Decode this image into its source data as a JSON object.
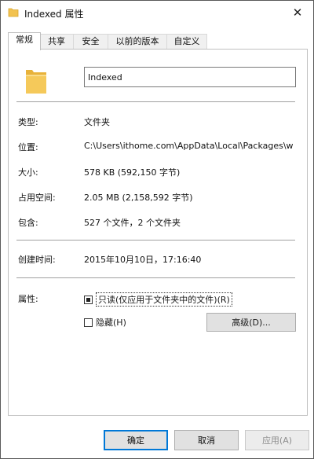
{
  "window": {
    "title": "Indexed 属性",
    "close_glyph": "✕"
  },
  "tabs": [
    {
      "label": "常规",
      "active": true
    },
    {
      "label": "共享",
      "active": false
    },
    {
      "label": "安全",
      "active": false
    },
    {
      "label": "以前的版本",
      "active": false
    },
    {
      "label": "自定义",
      "active": false
    }
  ],
  "general": {
    "folder_name": "Indexed",
    "type_label": "类型:",
    "type_value": "文件夹",
    "location_label": "位置:",
    "location_value": "C:\\Users\\ithome.com\\AppData\\Local\\Packages\\w",
    "size_label": "大小:",
    "size_value": "578 KB (592,150 字节)",
    "disk_size_label": "占用空间:",
    "disk_size_value": "2.05 MB (2,158,592 字节)",
    "contains_label": "包含:",
    "contains_value": "527 个文件，2 个文件夹",
    "created_label": "创建时间:",
    "created_value": "2015年10月10日，17:16:40",
    "attributes_label": "属性:",
    "readonly_label": "只读(仅应用于文件夹中的文件)(R)",
    "readonly_state": "indeterminate",
    "hidden_label": "隐藏(H)",
    "hidden_state": "unchecked",
    "advanced_label": "高级(D)..."
  },
  "buttons": {
    "ok": "确定",
    "cancel": "取消",
    "apply": "应用(A)"
  },
  "colors": {
    "folder": "#f2c24f",
    "focus_border": "#0078d7",
    "button_bg": "#e1e1e1"
  },
  "icons": {
    "title": "folder-icon",
    "close": "close-icon",
    "folder": "folder-icon"
  }
}
